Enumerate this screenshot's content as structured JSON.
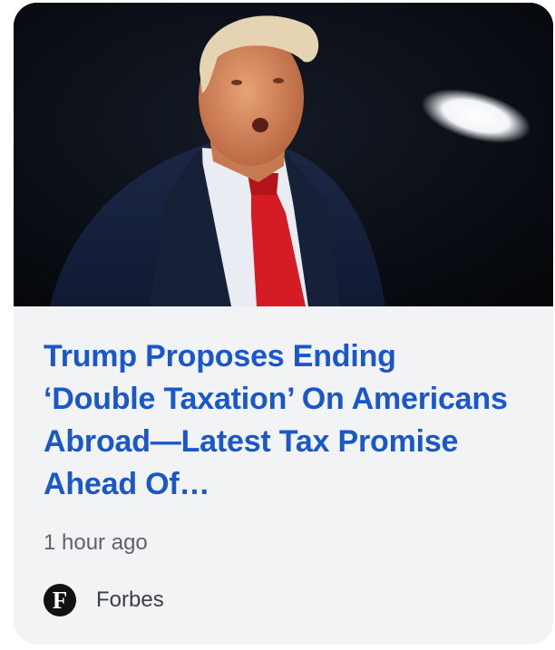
{
  "card": {
    "image_alt_icon": "news-photo",
    "headline": "Trump Proposes Ending ‘Double Taxation’ On Americans Abroad—Latest Tax Promise Ahead Of…",
    "time": "1 hour ago",
    "source": {
      "logo_letter": "F",
      "name": "Forbes"
    }
  },
  "colors": {
    "headline": "#1a57c9",
    "card_background": "#f1f3f4",
    "meta_text": "#5f6368"
  }
}
